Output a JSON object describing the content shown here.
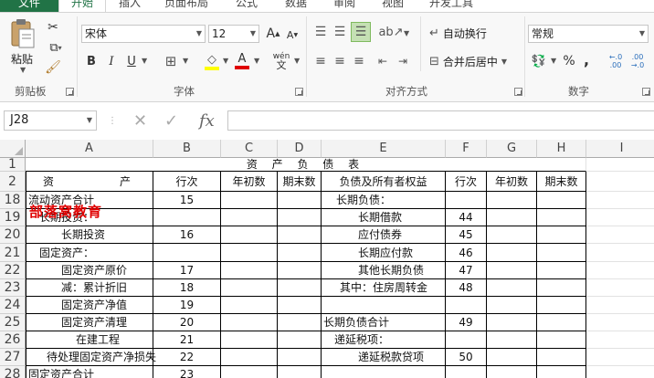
{
  "tabs": [
    {
      "label": "文件"
    },
    {
      "label": "开始"
    },
    {
      "label": "插入"
    },
    {
      "label": "页面布局"
    },
    {
      "label": "公式"
    },
    {
      "label": "数据"
    },
    {
      "label": "审阅"
    },
    {
      "label": "视图"
    },
    {
      "label": "开发工具"
    }
  ],
  "ribbon": {
    "clipboard": {
      "label": "剪贴板",
      "paste": "粘贴"
    },
    "font": {
      "label": "字体",
      "name": "宋体",
      "size": "12",
      "bold": "B",
      "italic": "I",
      "underline": "U",
      "phonetic": "wén"
    },
    "alignment": {
      "label": "对齐方式",
      "wrap": "自动换行",
      "merge": "合并后居中"
    },
    "number": {
      "label": "数字",
      "format": "常规",
      "percent": "%",
      "comma": ","
    }
  },
  "formula_bar": {
    "cell_ref": "J28",
    "formula": ""
  },
  "colors": {
    "accent": "#217346",
    "watermark": "#e00000"
  },
  "sheet": {
    "columns": [
      "A",
      "B",
      "C",
      "D",
      "E",
      "F",
      "G",
      "H",
      "I"
    ],
    "rows": [
      {
        "num": "1",
        "cells": [
          "",
          "",
          "",
          "",
          "资 产 负 债 表",
          "",
          "",
          "",
          ""
        ]
      },
      {
        "num": "2",
        "cells": [
          "资　　　　　　产",
          "行次",
          "年初数",
          "期末数",
          "负债及所有者权益",
          "行次",
          "年初数",
          "期末数",
          ""
        ]
      },
      {
        "num": "18",
        "cells": [
          "流动资产合计",
          "15",
          "",
          "",
          "长期负债：",
          "",
          "",
          "",
          ""
        ]
      },
      {
        "num": "19",
        "cells": [
          "长期投资：",
          "",
          "",
          "",
          "长期借款",
          "44",
          "",
          "",
          ""
        ]
      },
      {
        "num": "20",
        "cells": [
          "长期投资",
          "16",
          "",
          "",
          "应付债券",
          "45",
          "",
          "",
          ""
        ]
      },
      {
        "num": "21",
        "cells": [
          "固定资产：",
          "",
          "",
          "",
          "长期应付款",
          "46",
          "",
          "",
          ""
        ]
      },
      {
        "num": "22",
        "cells": [
          "固定资产原价",
          "17",
          "",
          "",
          "其他长期负债",
          "47",
          "",
          "",
          ""
        ]
      },
      {
        "num": "23",
        "cells": [
          "减：累计折旧",
          "18",
          "",
          "",
          "其中：住房周转金",
          "48",
          "",
          "",
          ""
        ]
      },
      {
        "num": "24",
        "cells": [
          "固定资产净值",
          "19",
          "",
          "",
          "",
          "",
          "",
          "",
          ""
        ]
      },
      {
        "num": "25",
        "cells": [
          "固定资产清理",
          "20",
          "",
          "",
          "长期负债合计",
          "49",
          "",
          "",
          ""
        ]
      },
      {
        "num": "26",
        "cells": [
          "在建工程",
          "21",
          "",
          "",
          "递延税项：",
          "",
          "",
          "",
          ""
        ]
      },
      {
        "num": "27",
        "cells": [
          "待处理固定资产净损失",
          "22",
          "",
          "",
          "递延税款贷项",
          "50",
          "",
          "",
          ""
        ]
      },
      {
        "num": "28",
        "cells": [
          "固定资产合计",
          "23",
          "",
          "",
          "",
          "",
          "",
          "",
          ""
        ]
      }
    ]
  },
  "watermark": "部落窝教育"
}
